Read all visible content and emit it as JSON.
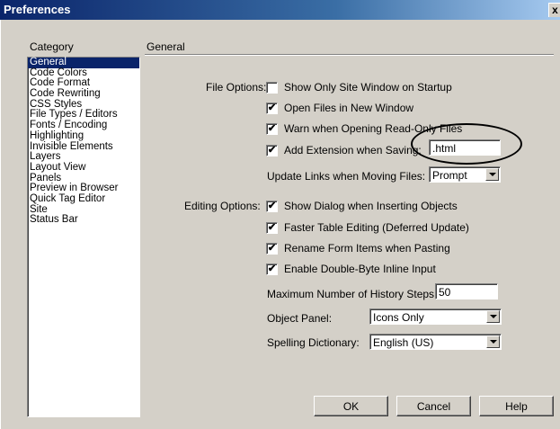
{
  "window": {
    "title": "Preferences",
    "close_label": "x"
  },
  "category": {
    "label": "Category",
    "items": [
      "General",
      "Code Colors",
      "Code Format",
      "Code Rewriting",
      "CSS Styles",
      "File Types / Editors",
      "Fonts / Encoding",
      "Highlighting",
      "Invisible Elements",
      "Layers",
      "Layout View",
      "Panels",
      "Preview in Browser",
      "Quick Tag Editor",
      "Site",
      "Status Bar"
    ],
    "selected": "General"
  },
  "panel": {
    "heading": "General",
    "file_options": {
      "label": "File Options:",
      "show_only_site": {
        "label": "Show Only Site Window on Startup",
        "checked": false
      },
      "open_new_window": {
        "label": "Open Files in New Window",
        "checked": true
      },
      "warn_readonly": {
        "label": "Warn when Opening Read-Only Files",
        "checked": true
      },
      "add_extension": {
        "label": "Add Extension when Saving:",
        "checked": true,
        "value": ".html"
      },
      "update_links": {
        "label": "Update Links when Moving Files:",
        "value": "Prompt"
      }
    },
    "editing_options": {
      "label": "Editing Options:",
      "show_dialog": {
        "label": "Show Dialog when Inserting Objects",
        "checked": true
      },
      "faster_table": {
        "label": "Faster Table Editing (Deferred Update)",
        "checked": true
      },
      "rename_form": {
        "label": "Rename Form Items when Pasting",
        "checked": true
      },
      "double_byte": {
        "label": "Enable Double-Byte Inline Input",
        "checked": true
      },
      "history_steps": {
        "label": "Maximum Number of History Steps:",
        "value": "50"
      },
      "object_panel": {
        "label": "Object Panel:",
        "value": "Icons Only"
      },
      "spelling": {
        "label": "Spelling Dictionary:",
        "value": "English (US)"
      }
    }
  },
  "buttons": {
    "ok": "OK",
    "cancel": "Cancel",
    "help": "Help"
  },
  "check_glyph": "✔"
}
